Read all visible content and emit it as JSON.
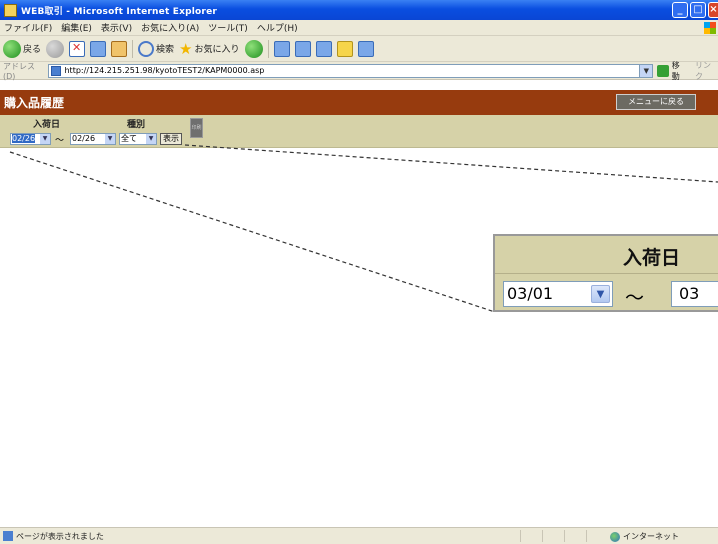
{
  "window": {
    "title": "WEB取引 - Microsoft Internet Explorer",
    "buttons": [
      "_",
      "□",
      "×"
    ]
  },
  "menubar": {
    "items": [
      "ファイル(F)",
      "編集(E)",
      "表示(V)",
      "お気に入り(A)",
      "ツール(T)",
      "ヘルプ(H)"
    ]
  },
  "toolbar": {
    "back_label": "戻る",
    "search_label": "検索",
    "favorites_label": "お気に入り"
  },
  "address": {
    "label": "アドレス(D)",
    "url": "http://124.215.251.98/kyotoTEST2/KAPM0000.asp",
    "go_label": "移動",
    "links_label": "リンク"
  },
  "page": {
    "title": "購入品履歴",
    "menu_button": "メニューに戻る"
  },
  "filter": {
    "arrival_label": "入荷日",
    "type_label": "種別",
    "from_date": "02/26",
    "separator": "～",
    "to_date": "02/26",
    "type_value": "全て",
    "show_button": "表示",
    "print_button": "印刷"
  },
  "callout": {
    "title": "入荷日",
    "from_date": "03/01",
    "separator": "～",
    "to_date_partial": "03"
  },
  "statusbar": {
    "message": "ページが表示されました",
    "zone": "インターネット"
  },
  "colors": {
    "titlebar": "#0a4ee0",
    "page_header": "#973b0e",
    "filter_bg": "#d6d2a8"
  }
}
